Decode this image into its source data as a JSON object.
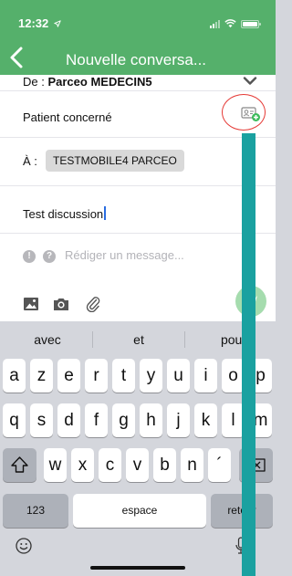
{
  "status_bar": {
    "time": "12:32",
    "location_icon": "location-arrow-icon",
    "signal_icon": "cellular-signal-icon",
    "wifi_icon": "wifi-icon",
    "battery_icon": "battery-icon"
  },
  "nav": {
    "back_icon": "chevron-left-icon",
    "title": "Nouvelle conversa..."
  },
  "form": {
    "from_prefix": "De : ",
    "from_value": "Parceo MEDECIN5",
    "from_expand_icon": "chevron-down-icon",
    "patient_label": "Patient concerné",
    "patient_add_icon": "patient-card-add-icon",
    "to_label": "À :",
    "to_recipient": "TESTMOBILE4 PARCEO",
    "subject_value": "Test discussion",
    "message_placeholder": "Rédiger un message...",
    "priority_icon": "exclamation-icon",
    "help_icon": "question-icon",
    "tools": [
      "image-icon",
      "camera-icon",
      "paperclip-icon"
    ],
    "send_icon": "send-icon"
  },
  "keyboard": {
    "suggestions": [
      "avec",
      "et",
      "pour"
    ],
    "row1": [
      "a",
      "z",
      "e",
      "r",
      "t",
      "y",
      "u",
      "i",
      "o",
      "p"
    ],
    "row2": [
      "q",
      "s",
      "d",
      "f",
      "g",
      "h",
      "j",
      "k",
      "l",
      "m"
    ],
    "row3": [
      "w",
      "x",
      "c",
      "v",
      "b",
      "n",
      "´"
    ],
    "shift_icon": "shift-icon",
    "delete_icon": "delete-icon",
    "numbers_label": "123",
    "space_label": "espace",
    "return_label": "retour",
    "emoji_icon": "emoji-icon",
    "mic_icon": "microphone-icon"
  },
  "colors": {
    "header": "#55b06b",
    "annotation_ring": "#e53935",
    "annotation_bar": "#1aa1a0",
    "send_button": "#a5dcae"
  }
}
